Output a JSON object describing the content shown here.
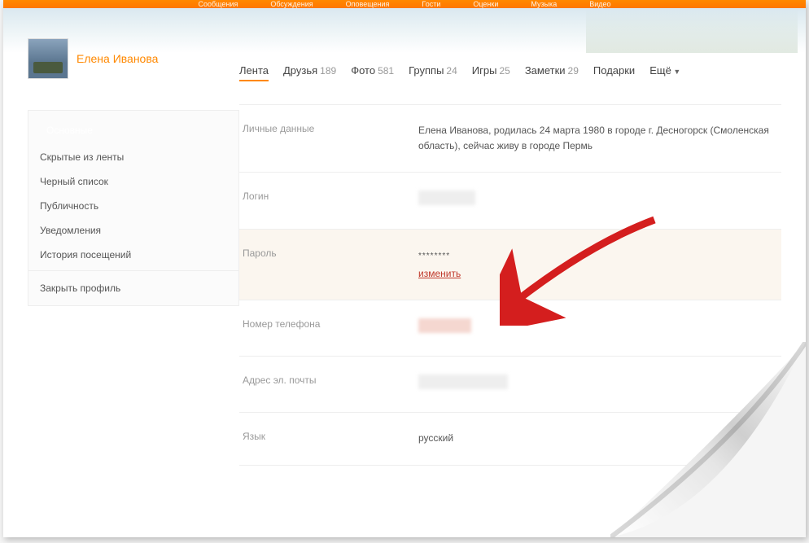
{
  "topnav": [
    "Сообщения",
    "Обсуждения",
    "Оповещения",
    "Гости",
    "Оценки",
    "Музыка",
    "Видео"
  ],
  "profile": {
    "name": "Елена Иванова"
  },
  "tabs": [
    {
      "label": "Лента",
      "count": ""
    },
    {
      "label": "Друзья",
      "count": "189"
    },
    {
      "label": "Фото",
      "count": "581"
    },
    {
      "label": "Группы",
      "count": "24"
    },
    {
      "label": "Игры",
      "count": "25"
    },
    {
      "label": "Заметки",
      "count": "29"
    },
    {
      "label": "Подарки",
      "count": ""
    },
    {
      "label": "Ещё",
      "count": ""
    }
  ],
  "sidebar": {
    "group1": [
      "Основные",
      "Скрытые из ленты",
      "Черный список",
      "Публичность",
      "Уведомления",
      "История посещений"
    ],
    "group2": [
      "Закрыть профиль"
    ]
  },
  "fields": {
    "personal_label": "Личные данные",
    "personal_value": "Елена Иванова, родилась 24 марта 1980 в городе г. Десногорск (Смоленская область), сейчас живу в городе Пермь",
    "login_label": "Логин",
    "password_label": "Пароль",
    "password_mask": "********",
    "change_label": "изменить",
    "phone_label": "Номер телефона",
    "email_label": "Адрес эл. почты",
    "language_label": "Язык",
    "language_value": "русский"
  }
}
